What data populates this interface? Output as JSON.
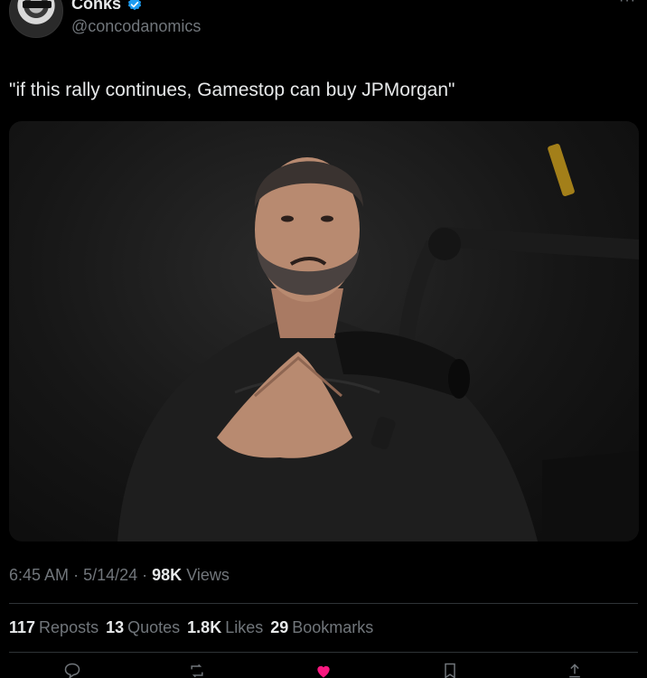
{
  "author": {
    "name": "Conks",
    "handle": "@concodanomics",
    "verified_color": "#1d9bf0"
  },
  "tweet": {
    "text": "\"if this rally continues, Gamestop can buy JPMorgan\""
  },
  "meta": {
    "time": "6:45 AM",
    "date": "5/14/24",
    "views_count": "98K",
    "views_label": "Views"
  },
  "stats": {
    "reposts_count": "117",
    "reposts_label": "Reposts",
    "quotes_count": "13",
    "quotes_label": "Quotes",
    "likes_count": "1.8K",
    "likes_label": "Likes",
    "bookmarks_count": "29",
    "bookmarks_label": "Bookmarks"
  },
  "colors": {
    "background": "#000000",
    "text_primary": "#e7e9ea",
    "text_secondary": "#71767b",
    "divider": "#2f3336",
    "like_active": "#f91880"
  },
  "icons": {
    "more": "more-dots-icon",
    "verified": "verified-badge-icon",
    "reply": "reply-icon",
    "repost": "repost-icon",
    "like": "heart-icon",
    "bookmark": "bookmark-icon",
    "share": "share-icon"
  }
}
